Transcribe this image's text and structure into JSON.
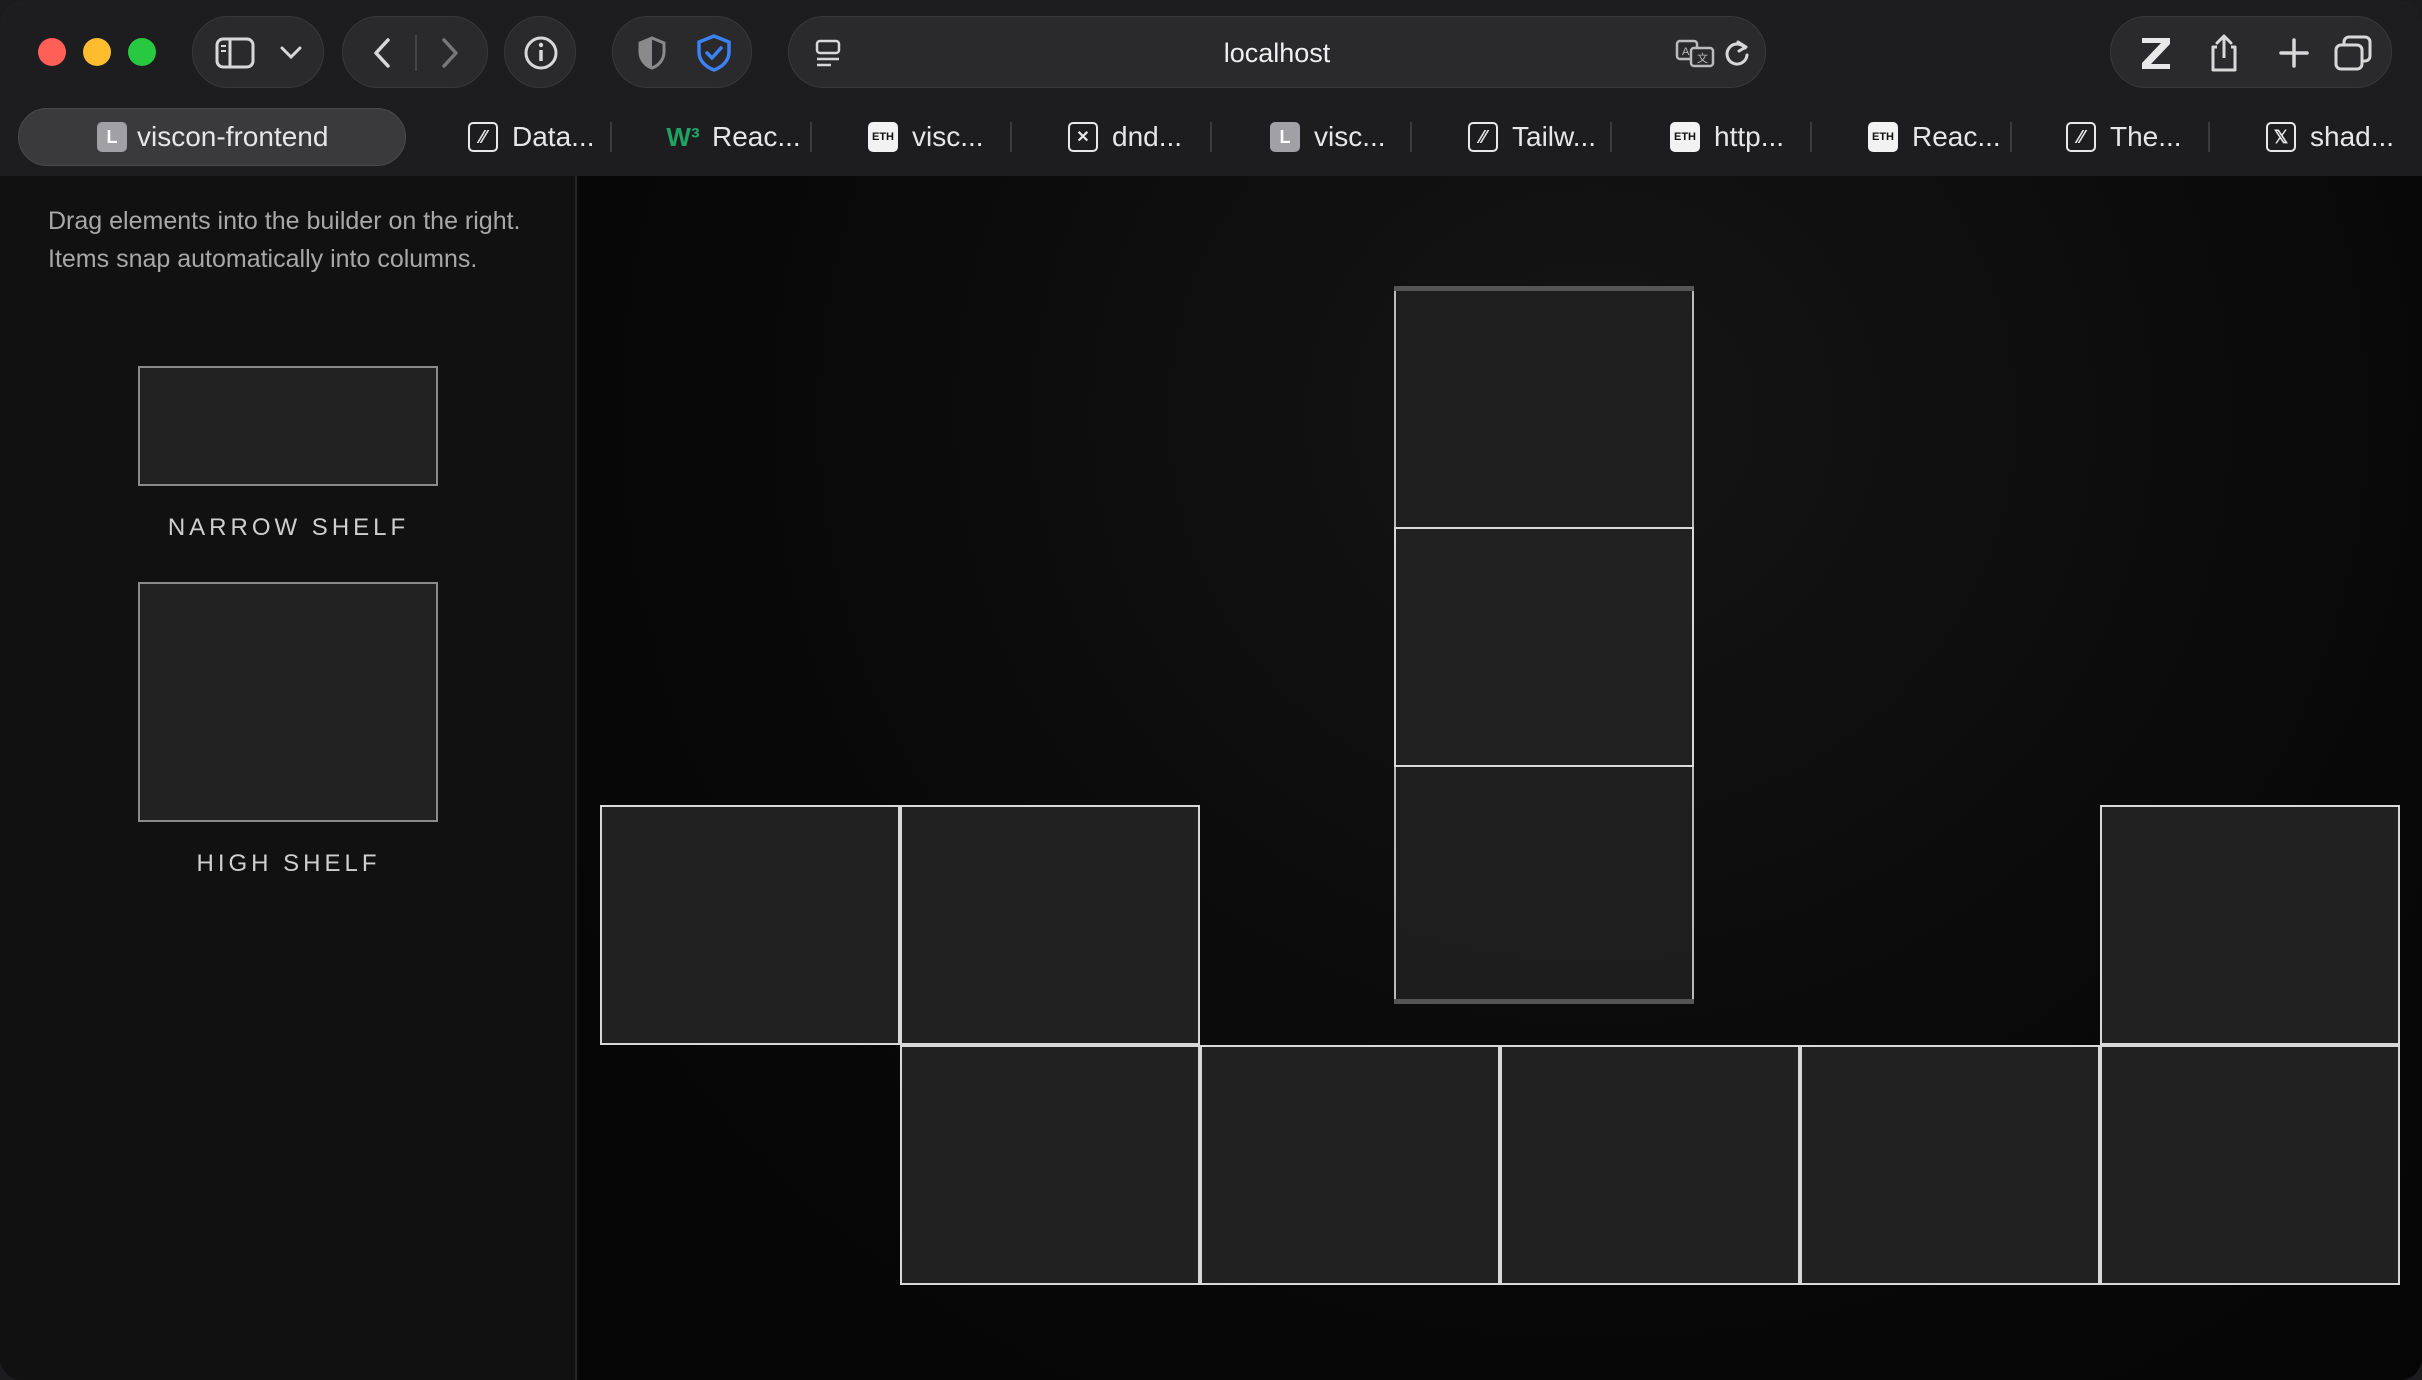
{
  "browser": {
    "url": "localhost",
    "tabs": [
      {
        "title": "viscon-frontend",
        "favicon": "L",
        "active": true
      },
      {
        "title": "Data...",
        "favicon": "slash"
      },
      {
        "title": "Reac...",
        "favicon": "W3"
      },
      {
        "title": "visc...",
        "favicon": "ETH"
      },
      {
        "title": "dnd...",
        "favicon": "dnd"
      },
      {
        "title": "visc...",
        "favicon": "L"
      },
      {
        "title": "Tailw...",
        "favicon": "slash"
      },
      {
        "title": "http...",
        "favicon": "ETH"
      },
      {
        "title": "Reac...",
        "favicon": "ETH"
      },
      {
        "title": "The...",
        "favicon": "slash"
      },
      {
        "title": "shad...",
        "favicon": "X"
      }
    ]
  },
  "sidebar": {
    "help_text": "Drag elements into the builder on the right. Items snap automatically into columns.",
    "elements": [
      {
        "label": "NARROW SHELF"
      },
      {
        "label": "HIGH SHELF"
      }
    ]
  },
  "colors": {
    "window_bg": "#0a0a0a",
    "sidebar_bg": "#111111",
    "cell_fill": "#212121",
    "cell_border": "#d9d9d9",
    "traffic_red": "#ff5f57",
    "traffic_yellow": "#febc2e",
    "traffic_green": "#28c840",
    "shield_blue": "#3b82f6"
  }
}
